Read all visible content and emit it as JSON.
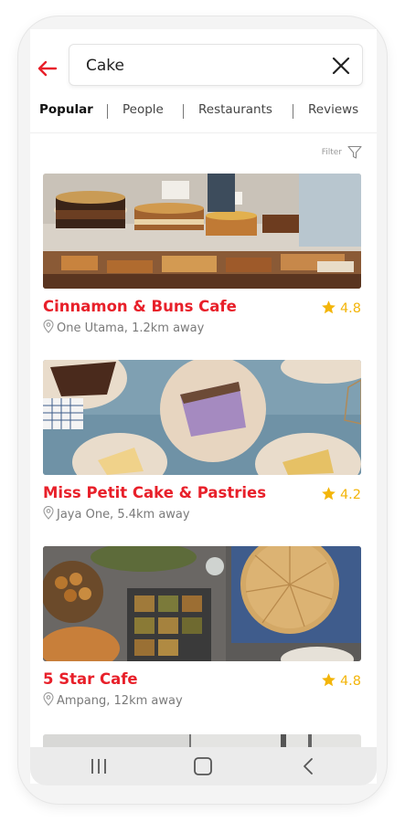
{
  "search": {
    "value": "Cake"
  },
  "tabs": [
    {
      "label": "Popular",
      "active": true
    },
    {
      "label": "People",
      "active": false
    },
    {
      "label": "Restaurants",
      "active": false
    },
    {
      "label": "Reviews",
      "active": false
    }
  ],
  "filter": {
    "label": "Filter"
  },
  "results": [
    {
      "name": "Cinnamon & Buns Cafe",
      "rating": "4.8",
      "location": "One Utama, 1.2km away"
    },
    {
      "name": "Miss Petit Cake & Pastries",
      "rating": "4.2",
      "location": "Jaya One, 5.4km away"
    },
    {
      "name": "5 Star Cafe",
      "rating": "4.8",
      "location": "Ampang, 12km away"
    }
  ],
  "colors": {
    "accent": "#e8202a",
    "rating": "#f3b50a",
    "muted": "#7a7a7a"
  },
  "icons": {
    "back": "arrow-left-icon",
    "clear": "close-icon",
    "filter": "funnel-icon",
    "rating": "star-icon",
    "location": "map-pin-icon",
    "nav": [
      "recents-icon",
      "home-icon",
      "back-chevron-icon"
    ]
  }
}
